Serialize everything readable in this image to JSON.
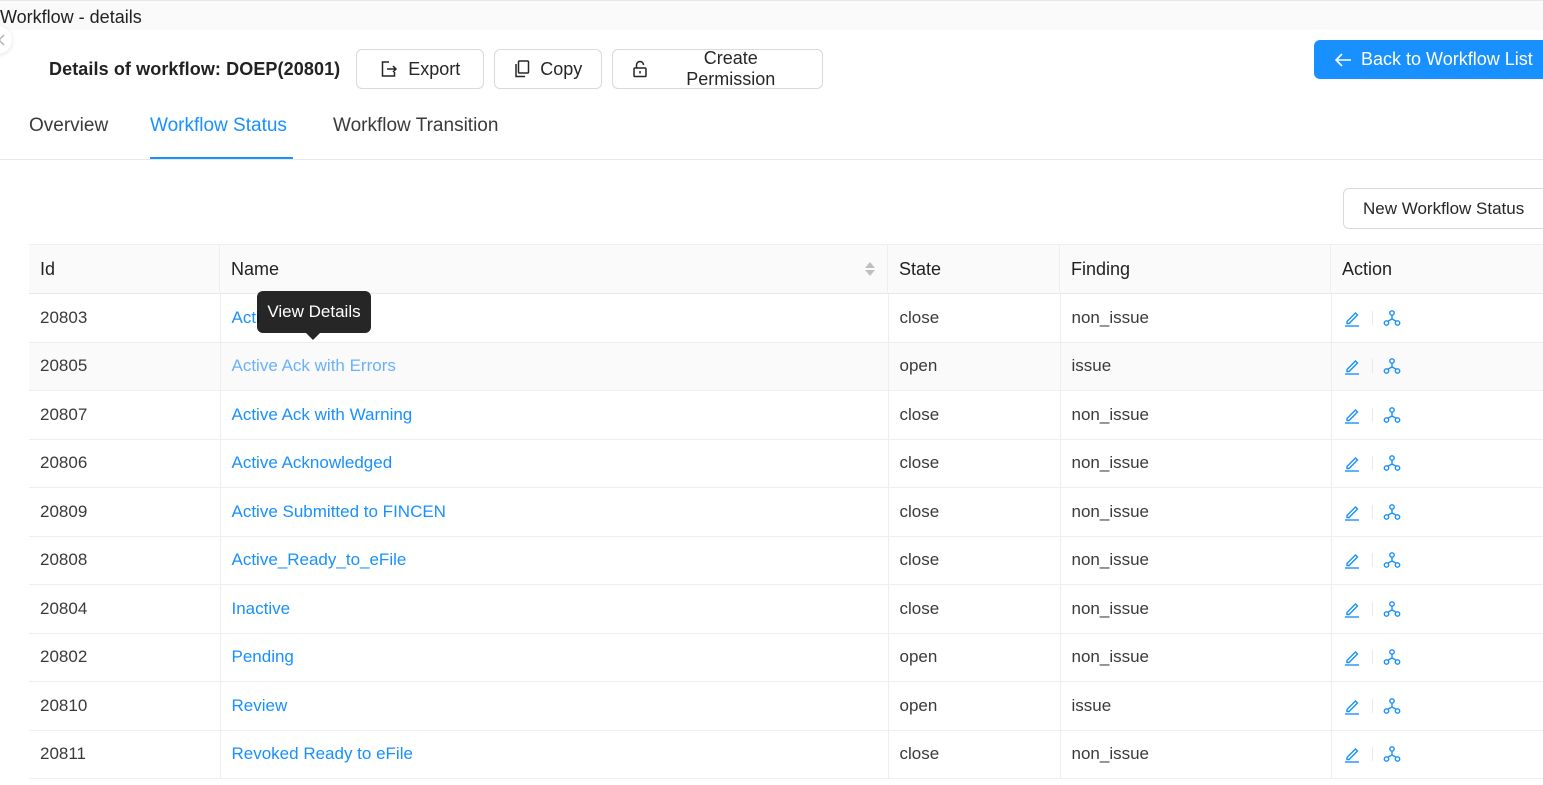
{
  "window": {
    "title": "Workflow - details"
  },
  "header": {
    "details_title": "Details of workflow: DOEP(20801)",
    "buttons": {
      "export": "Export",
      "copy": "Copy",
      "create_permission": "Create Permission"
    },
    "back_button": "Back to Workflow List"
  },
  "tabs": [
    {
      "label": "Overview",
      "active": false
    },
    {
      "label": "Workflow Status",
      "active": true
    },
    {
      "label": "Workflow Transition",
      "active": false
    }
  ],
  "toolbar": {
    "new_status_button": "New Workflow Status"
  },
  "table": {
    "columns": [
      "Id",
      "Name",
      "State",
      "Finding",
      "Action"
    ],
    "rows": [
      {
        "id": "20803",
        "name": "Acti",
        "state": "close",
        "finding": "non_issue"
      },
      {
        "id": "20805",
        "name": "Active Ack with Errors",
        "state": "open",
        "finding": "issue"
      },
      {
        "id": "20807",
        "name": "Active Ack with Warning",
        "state": "close",
        "finding": "non_issue"
      },
      {
        "id": "20806",
        "name": "Active Acknowledged",
        "state": "close",
        "finding": "non_issue"
      },
      {
        "id": "20809",
        "name": "Active Submitted to FINCEN",
        "state": "close",
        "finding": "non_issue"
      },
      {
        "id": "20808",
        "name": "Active_Ready_to_eFile",
        "state": "close",
        "finding": "non_issue"
      },
      {
        "id": "20804",
        "name": "Inactive",
        "state": "close",
        "finding": "non_issue"
      },
      {
        "id": "20802",
        "name": "Pending",
        "state": "open",
        "finding": "non_issue"
      },
      {
        "id": "20810",
        "name": "Review",
        "state": "open",
        "finding": "issue"
      },
      {
        "id": "20811",
        "name": "Revoked Ready to eFile",
        "state": "close",
        "finding": "non_issue"
      }
    ]
  },
  "tooltip": {
    "text": "View Details"
  },
  "colors": {
    "primary": "#1890ff",
    "hover_link": "#69b1ff",
    "tooltip_bg": "#262626"
  },
  "icons": {
    "edit": "edit-icon",
    "workflow": "workflow-icon",
    "export": "export-icon",
    "copy": "copy-icon",
    "lock": "lock-icon",
    "back": "arrow-left-icon",
    "sort": "sort-icon"
  }
}
